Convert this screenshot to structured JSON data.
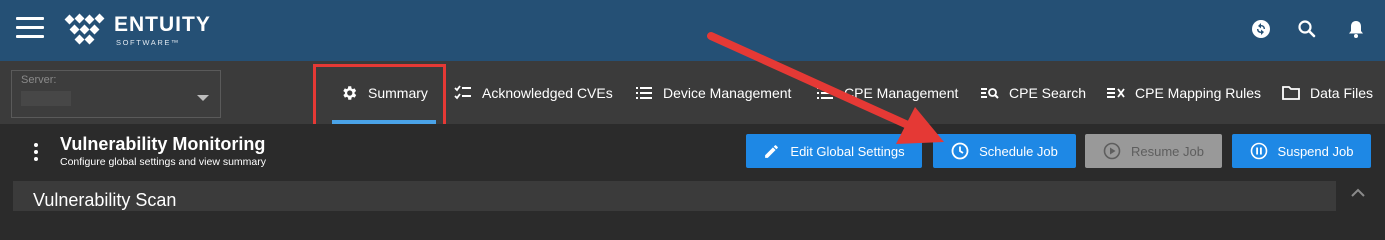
{
  "app": {
    "logo_name": "ENTUITY",
    "logo_sub": "SOFTWARE™"
  },
  "header_icons": [
    "sync-status-icon",
    "search-icon",
    "bell-icon"
  ],
  "server": {
    "label": "Server:",
    "value": ""
  },
  "tabs": [
    {
      "label": "Summary",
      "icon": "gear-icon",
      "active": true
    },
    {
      "label": "Acknowledged CVEs",
      "icon": "checklist-icon"
    },
    {
      "label": "Device Management",
      "icon": "list-icon"
    },
    {
      "label": "CPE Management",
      "icon": "list-icon"
    },
    {
      "label": "CPE Search",
      "icon": "search-list-icon"
    },
    {
      "label": "CPE Mapping Rules",
      "icon": "mapping-rules-icon"
    },
    {
      "label": "Data Files",
      "icon": "folder-icon"
    }
  ],
  "page": {
    "title": "Vulnerability Monitoring",
    "subtitle": "Configure global settings and view summary"
  },
  "actions": {
    "edit_global_settings": "Edit Global Settings",
    "schedule_job": "Schedule Job",
    "resume_job": "Resume Job",
    "suspend_job": "Suspend Job"
  },
  "panel": {
    "title": "Vulnerability Scan"
  },
  "colors": {
    "topbar": "#255075",
    "accent": "#1e88e5",
    "annotation": "#e53935"
  }
}
